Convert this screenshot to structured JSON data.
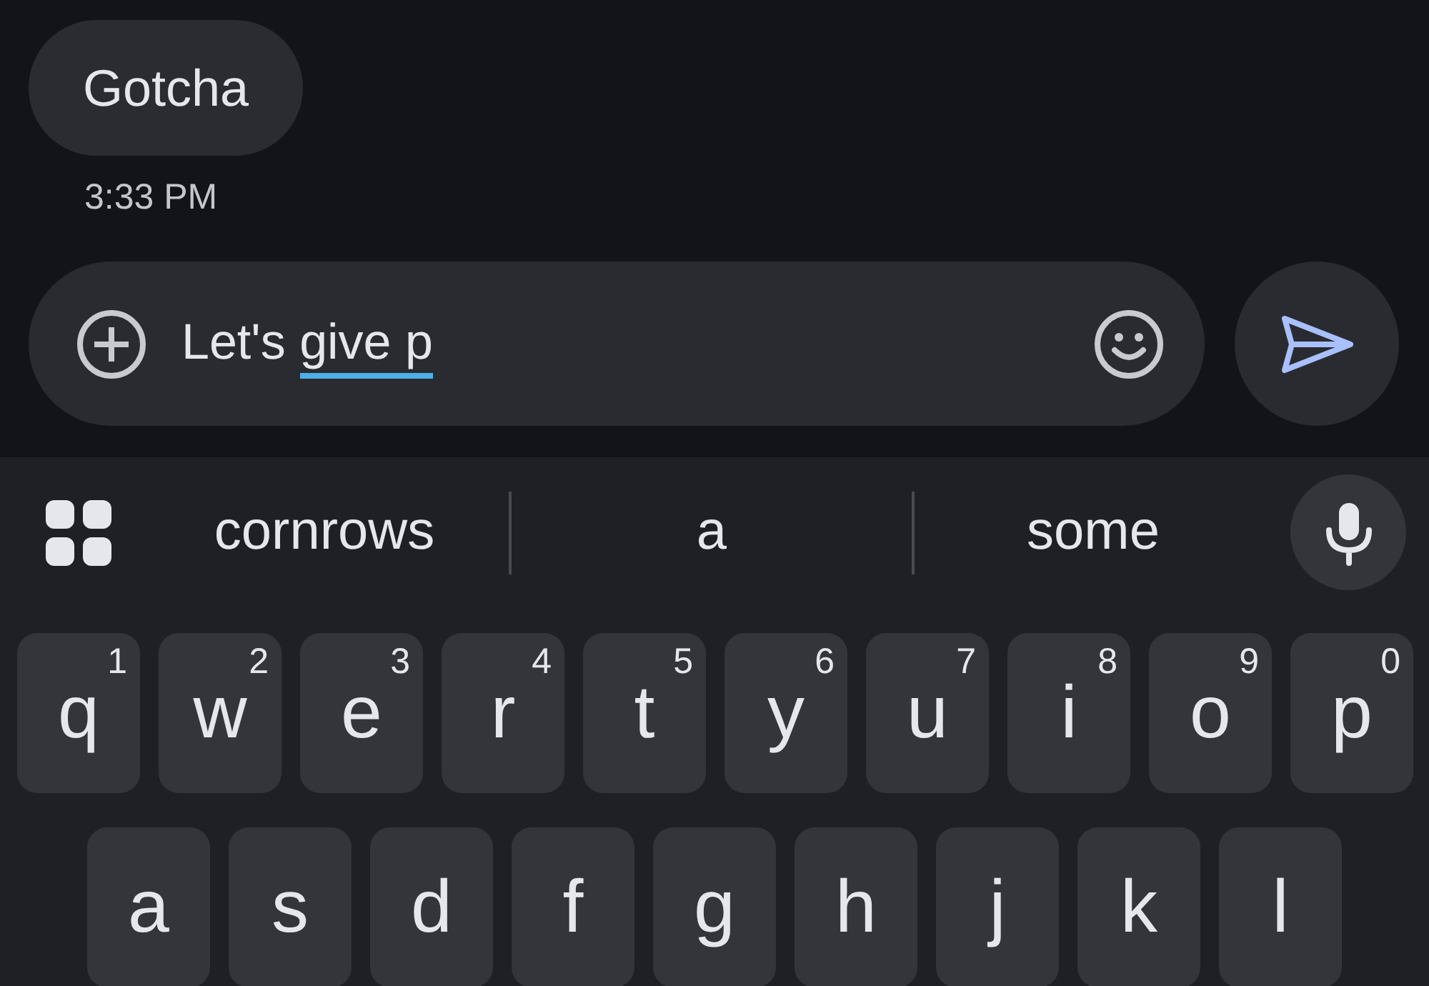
{
  "messages": [
    {
      "text": "Gotcha",
      "time": "3:33 PM"
    }
  ],
  "compose": {
    "text": "Let's ",
    "composing": "give p"
  },
  "suggestions": [
    "cornrows",
    "a",
    "some"
  ],
  "keyboard": {
    "rows": [
      [
        {
          "label": "q",
          "hint": "1"
        },
        {
          "label": "w",
          "hint": "2"
        },
        {
          "label": "e",
          "hint": "3"
        },
        {
          "label": "r",
          "hint": "4"
        },
        {
          "label": "t",
          "hint": "5"
        },
        {
          "label": "y",
          "hint": "6"
        },
        {
          "label": "u",
          "hint": "7"
        },
        {
          "label": "i",
          "hint": "8"
        },
        {
          "label": "o",
          "hint": "9"
        },
        {
          "label": "p",
          "hint": "0"
        }
      ],
      [
        {
          "label": "a"
        },
        {
          "label": "s"
        },
        {
          "label": "d"
        },
        {
          "label": "f"
        },
        {
          "label": "g"
        },
        {
          "label": "h"
        },
        {
          "label": "j"
        },
        {
          "label": "k"
        },
        {
          "label": "l"
        }
      ]
    ]
  }
}
